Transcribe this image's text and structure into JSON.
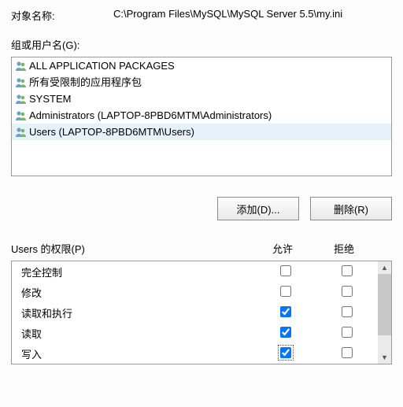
{
  "object": {
    "label": "对象名称:",
    "value": "C:\\Program Files\\MySQL\\MySQL Server 5.5\\my.ini"
  },
  "groups": {
    "label": "组或用户名(G):",
    "items": [
      {
        "name": "ALL APPLICATION PACKAGES",
        "selected": false
      },
      {
        "name": "所有受限制的应用程序包",
        "selected": false
      },
      {
        "name": "SYSTEM",
        "selected": false
      },
      {
        "name": "Administrators (LAPTOP-8PBD6MTM\\Administrators)",
        "selected": false
      },
      {
        "name": "Users (LAPTOP-8PBD6MTM\\Users)",
        "selected": true
      }
    ]
  },
  "buttons": {
    "add": "添加(D)...",
    "remove": "删除(R)"
  },
  "permissions": {
    "label": "Users 的权限(P)",
    "allowLabel": "允许",
    "denyLabel": "拒绝",
    "items": [
      {
        "name": "完全控制",
        "allow": false,
        "deny": false
      },
      {
        "name": "修改",
        "allow": false,
        "deny": false
      },
      {
        "name": "读取和执行",
        "allow": true,
        "deny": false
      },
      {
        "name": "读取",
        "allow": true,
        "deny": false
      },
      {
        "name": "写入",
        "allow": true,
        "deny": false,
        "focused": true
      }
    ]
  }
}
